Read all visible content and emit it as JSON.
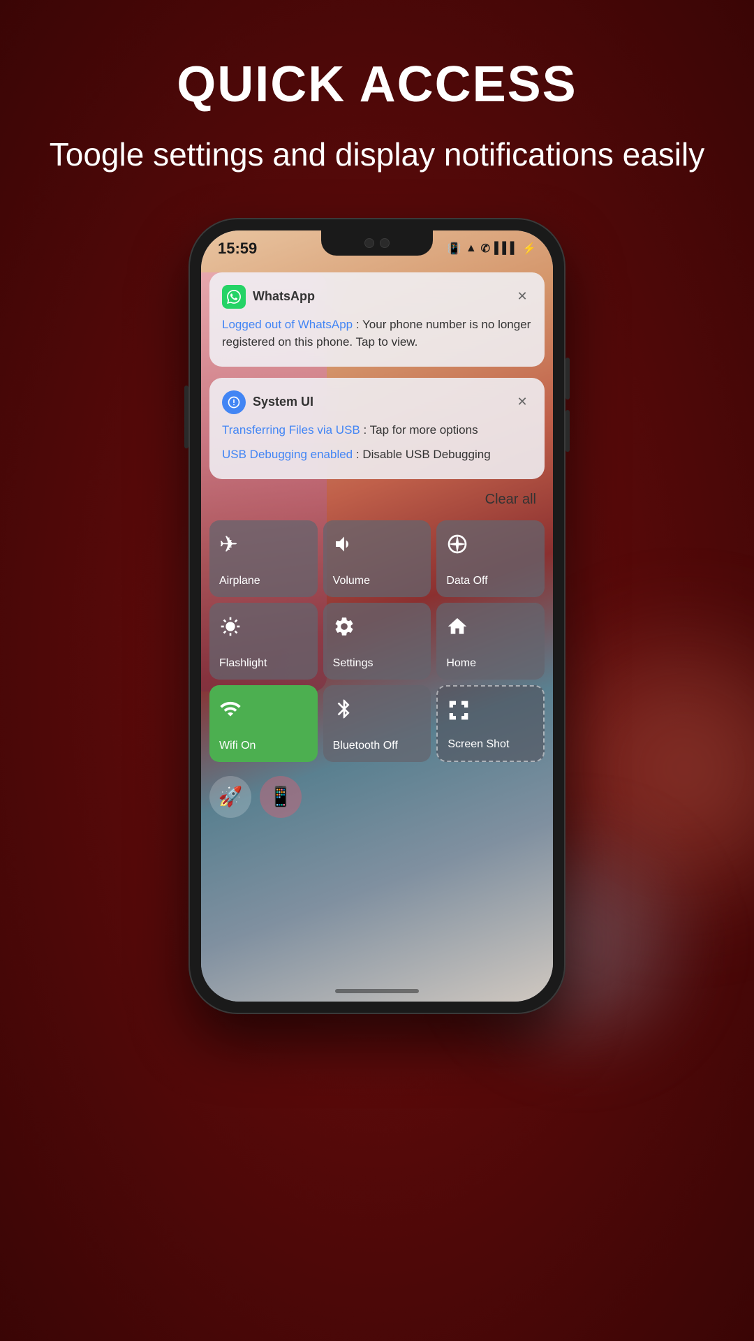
{
  "page": {
    "header": {
      "title": "QUICK ACCESS",
      "subtitle": "Toogle settings and display notifications easily"
    }
  },
  "phone": {
    "statusBar": {
      "time": "15:59",
      "icons": [
        "🔔",
        "📶",
        "📡",
        "🔋"
      ]
    },
    "notifications": [
      {
        "id": "whatsapp",
        "appName": "WhatsApp",
        "iconEmoji": "💬",
        "iconColor": "#25D366",
        "linkText": "Logged out of WhatsApp",
        "bodyText": " : Your phone number is no longer registered on this phone. Tap to view."
      },
      {
        "id": "systemui",
        "appName": "System UI",
        "iconEmoji": "🤖",
        "iconColor": "#4285F4",
        "items": [
          {
            "linkText": "Transferring Files via USB",
            "bodyText": " : Tap for more options"
          },
          {
            "linkText": "USB Debugging enabled",
            "bodyText": " : Disable USB Debugging"
          }
        ]
      }
    ],
    "clearAll": "Clear all",
    "quickSettings": {
      "tiles": [
        {
          "id": "airplane",
          "icon": "✈",
          "label": "Airplane",
          "active": false
        },
        {
          "id": "volume",
          "icon": "🔊",
          "label": "Volume",
          "active": false
        },
        {
          "id": "data",
          "icon": "📡",
          "label": "Data Off",
          "active": false
        },
        {
          "id": "flashlight",
          "icon": "☀",
          "label": "Flashlight",
          "active": false
        },
        {
          "id": "settings",
          "icon": "⚙",
          "label": "Settings",
          "active": false
        },
        {
          "id": "home",
          "icon": "⌂",
          "label": "Home",
          "active": false
        },
        {
          "id": "wifi",
          "icon": "📶",
          "label": "Wifi On",
          "active": true
        },
        {
          "id": "bluetooth",
          "icon": "✱",
          "label": "Bluetooth Off",
          "active": false
        },
        {
          "id": "screenshot",
          "icon": "⬜",
          "label": "Screen Shot",
          "active": false
        }
      ]
    }
  }
}
